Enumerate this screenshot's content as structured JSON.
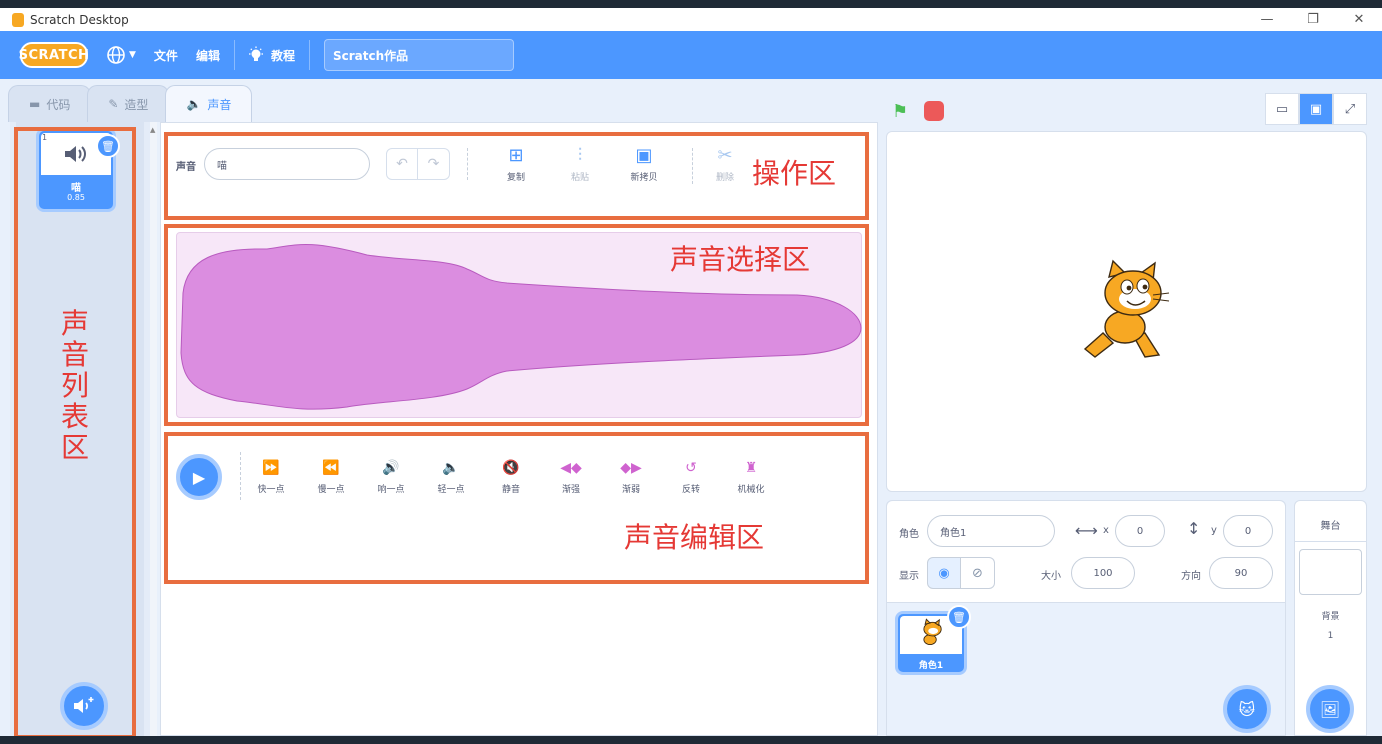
{
  "window": {
    "title": "Scratch Desktop",
    "controls": {
      "minimize": "—",
      "restore": "❐",
      "close": "✕"
    }
  },
  "menubar": {
    "logo": "SCRATCH",
    "language_icon": "globe-icon",
    "file": "文件",
    "edit": "编辑",
    "tutorials": "教程",
    "project_title": "Scratch作品"
  },
  "tabs": [
    {
      "label": "代码",
      "icon": "code-icon"
    },
    {
      "label": "造型",
      "icon": "brush-icon"
    },
    {
      "label": "声音",
      "icon": "speaker-icon",
      "active": true
    }
  ],
  "sound_list": {
    "items": [
      {
        "index": "1",
        "name": "喵",
        "duration": "0.85"
      }
    ]
  },
  "sound_editor": {
    "name_label": "声音",
    "name_value": "喵",
    "actions": [
      {
        "label": "复制",
        "icon": "copy-icon",
        "enabled": true
      },
      {
        "label": "粘贴",
        "icon": "paste-icon",
        "enabled": false
      },
      {
        "label": "新拷贝",
        "icon": "new-copy-icon",
        "enabled": true
      },
      {
        "label": "删除",
        "icon": "cut-icon",
        "enabled": false
      }
    ],
    "effects": [
      {
        "label": "快一点",
        "icon": "faster-icon"
      },
      {
        "label": "慢一点",
        "icon": "slower-icon"
      },
      {
        "label": "响一点",
        "icon": "louder-icon"
      },
      {
        "label": "轻一点",
        "icon": "softer-icon"
      },
      {
        "label": "静音",
        "icon": "mute-icon"
      },
      {
        "label": "渐强",
        "icon": "fade-in-icon"
      },
      {
        "label": "渐弱",
        "icon": "fade-out-icon"
      },
      {
        "label": "反转",
        "icon": "reverse-icon"
      },
      {
        "label": "机械化",
        "icon": "robot-icon"
      }
    ]
  },
  "annotations": {
    "ops_area": "操作区",
    "select_area": "声音选择区",
    "edit_area": "声音编辑区",
    "list_area": "声\n音\n列\n表\n区",
    "color": "#e86d3f",
    "text_color": "#e53935"
  },
  "sprite_info": {
    "sprite_label": "角色",
    "sprite_name": "角色1",
    "x_label": "x",
    "x_value": "0",
    "y_label": "y",
    "y_value": "0",
    "show_label": "显示",
    "size_label": "大小",
    "size_value": "100",
    "direction_label": "方向",
    "direction_value": "90"
  },
  "sprites": [
    {
      "name": "角色1"
    }
  ],
  "stage_panel": {
    "title": "舞台",
    "backdrop_label": "背景",
    "backdrop_count": "1"
  },
  "colors": {
    "primary": "#4c97ff",
    "sound_purple": "#cf63cf",
    "green_flag": "#4cbf56",
    "stop_red": "#ec5959"
  }
}
